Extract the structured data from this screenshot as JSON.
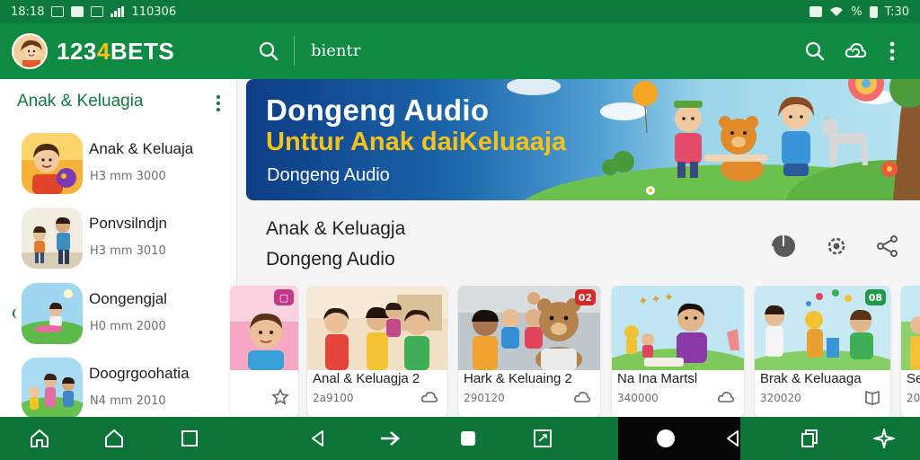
{
  "status_bar": {
    "left_time": "18:18",
    "left_extra": "110306",
    "right_battery": "%",
    "right_time": "T:30"
  },
  "app_bar": {
    "brand_prefix": "123",
    "brand_accent": "4",
    "brand_suffix": "BETS",
    "search_text": "bientr"
  },
  "sidebar": {
    "title": "Anak & Keluagia",
    "items": [
      {
        "name": "Anak & Keluaja",
        "meta": "H3 mm 3000"
      },
      {
        "name": "Ponvsilndjn",
        "meta": "H3 mm 3010"
      },
      {
        "name": "Oongengjal",
        "meta": "H0 mm 2000"
      },
      {
        "name": "Doogrgoohatia",
        "meta": "N4 mm 2010"
      }
    ]
  },
  "banner": {
    "title": "Dongeng Audio",
    "subtitle": "Unttur Anak daiKeluaaja",
    "tag": "Dongeng Audio"
  },
  "content_header": {
    "line1": "Anak & Keluagja",
    "line2": "Dongeng Audio"
  },
  "cards": [
    {
      "title": "",
      "meta": "",
      "badge": ""
    },
    {
      "title": "Anal & Keluagja 2",
      "meta": "2a9100",
      "badge": ""
    },
    {
      "title": "Hark & Keluaing 2",
      "meta": "290120",
      "badge": "02"
    },
    {
      "title": "Na Ina Martsl",
      "meta": "340000",
      "badge": ""
    },
    {
      "title": "Brak & Keluaaga",
      "meta": "320020",
      "badge": "08"
    },
    {
      "title": "Se",
      "meta": "20",
      "badge": ""
    }
  ],
  "colors": {
    "primary": "#0e8a43",
    "status": "#0c7a3a",
    "accent": "#f4c21a",
    "nav": "#0c7436"
  },
  "icons": {
    "app_bar": [
      "search-icon",
      "search-icon",
      "cloud-refresh-icon",
      "more-vertical-icon"
    ],
    "content_actions": [
      "pie-icon",
      "settings-icon",
      "share-icon"
    ],
    "nav": [
      "home-icon",
      "home-outline-icon",
      "square-icon",
      "back-icon",
      "forward-icon",
      "stop-icon",
      "picture-in-picture-icon",
      "record-icon",
      "back-triangle-icon",
      "recent-apps-icon",
      "sparkle-icon"
    ]
  }
}
